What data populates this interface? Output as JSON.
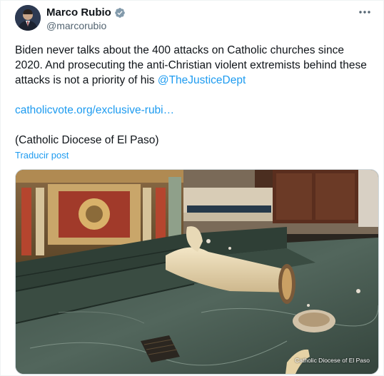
{
  "author": {
    "display_name": "Marco Rubio",
    "handle": "@marcorubio"
  },
  "tweet": {
    "text_part1": "Biden never talks about the 400 attacks on Catholic churches since 2020. And prosecuting the anti-Christian violent extremists behind these attacks is not a priority of his ",
    "mention": "@TheJusticeDept",
    "link": "catholicvote.org/exclusive-rubi…",
    "attribution": "(Catholic Diocese of El Paso)",
    "translate_label": "Traducir post"
  },
  "media": {
    "credit": "Catholic Diocese of El Paso"
  },
  "colors": {
    "accent": "#1d9bf0",
    "text": "#0f1419",
    "muted": "#536471"
  },
  "icons": {
    "verified": "verified-badge-icon",
    "more": "more-options-icon"
  }
}
